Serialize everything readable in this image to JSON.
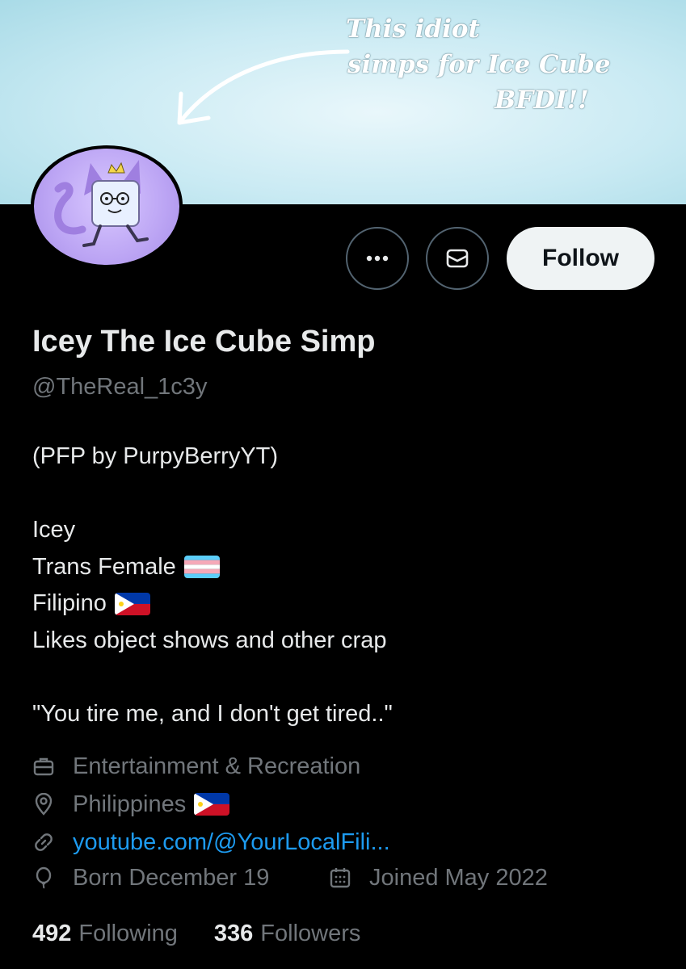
{
  "banner": {
    "note_lines": [
      "This idiot",
      "simps for Ice Cube",
      "BFDI!!"
    ]
  },
  "actions": {
    "follow_label": "Follow"
  },
  "profile": {
    "display_name": "Icey The Ice Cube Simp",
    "handle": "@TheReal_1c3y"
  },
  "bio": {
    "lines": [
      "(PFP by PurpyBerryYT)",
      "",
      "Icey",
      "Trans Female",
      "Filipino",
      "Likes object shows and other crap",
      "",
      "\"You tire me, and I don't get tired..\""
    ]
  },
  "meta": {
    "category": "Entertainment & Recreation",
    "location": "Philippines",
    "website": "youtube.com/@YourLocalFili...",
    "birthday": "Born December 19",
    "joined": "Joined May 2022"
  },
  "stats": {
    "following_count": "492",
    "following_label": "Following",
    "followers_count": "336",
    "followers_label": "Followers"
  },
  "colors": {
    "background": "#000000",
    "text_primary": "#e7e9ea",
    "text_secondary": "#71767b",
    "link": "#1d9bf0",
    "follow_button_bg": "#eff3f4",
    "border": "#536471"
  },
  "icons": {
    "more": "more-horizontal-icon",
    "mail": "mail-icon",
    "category": "briefcase-icon",
    "location": "location-pin-icon",
    "website": "link-icon",
    "birthday": "balloon-icon",
    "joined": "calendar-icon"
  }
}
